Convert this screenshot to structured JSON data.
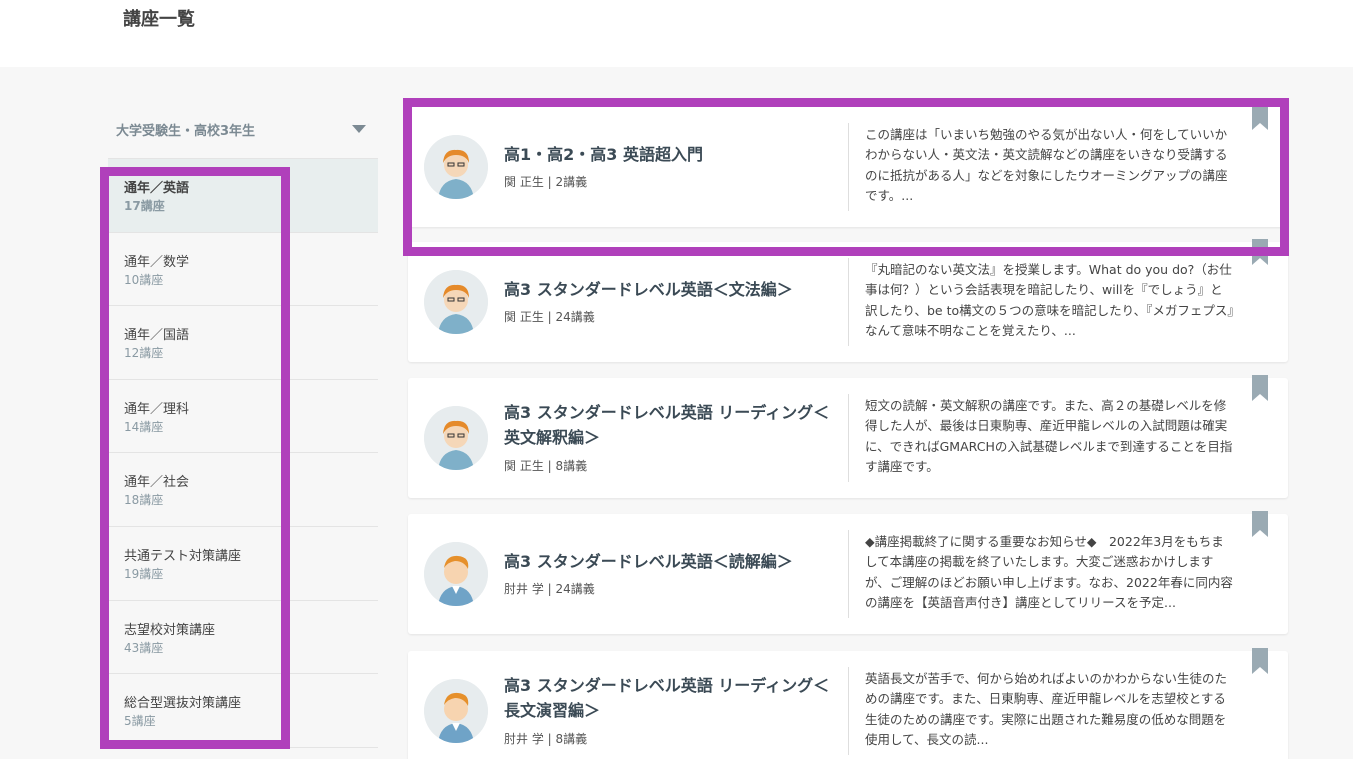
{
  "page": {
    "title": "講座一覧"
  },
  "sidebar": {
    "grade_selector": {
      "label": "大学受験生・高校3年生",
      "icon": "chevron-down-icon"
    },
    "categories": [
      {
        "name": "通年／英語",
        "count": "17講座",
        "active": true
      },
      {
        "name": "通年／数学",
        "count": "10講座"
      },
      {
        "name": "通年／国語",
        "count": "12講座"
      },
      {
        "name": "通年／理科",
        "count": "14講座"
      },
      {
        "name": "通年／社会",
        "count": "18講座"
      },
      {
        "name": "共通テスト対策講座",
        "count": "19講座"
      },
      {
        "name": "志望校対策講座",
        "count": "43講座"
      },
      {
        "name": "総合型選抜対策講座",
        "count": "5講座"
      }
    ]
  },
  "courses": [
    {
      "title": "高1・高2・高3 英語超入門",
      "meta": "関 正生 | 2講義",
      "description": "この講座は「いまいち勉強のやる気が出ない人・何をしていいかわからない人・英文法・英文読解などの講座をいきなり受講するのに抵抗がある人」などを対象にしたウオーミングアップの講座です。...",
      "avatar": "teacher-seki-avatar",
      "bookmark_icon": "bookmark-icon"
    },
    {
      "title": "高3 スタンダードレベル英語＜文法編＞",
      "meta": "関 正生 | 24講義",
      "description": "『丸暗記のない英文法』を授業します。What do you do?（お仕事は何？）という会話表現を暗記したり、willを『でしょう』と訳したり、be to構文の５つの意味を暗記したり、『メガフェプス』なんて意味不明なことを覚えたり、...",
      "avatar": "teacher-seki-avatar",
      "bookmark_icon": "bookmark-icon"
    },
    {
      "title": "高3 スタンダードレベル英語 リーディング＜英文解釈編＞",
      "meta": "関 正生 | 8講義",
      "description": "短文の読解・英文解釈の講座です。また、高２の基礎レベルを修得した人が、最後は日東駒専、産近甲龍レベルの入試問題は確実に、できればGMARCHの入試基礎レベルまで到達することを目指す講座です。",
      "avatar": "teacher-seki-avatar",
      "bookmark_icon": "bookmark-icon"
    },
    {
      "title": "高3 スタンダードレベル英語＜読解編＞",
      "meta": "肘井 学 | 24講義",
      "description": "◆講座掲載終了に関する重要なお知らせ◆　2022年3月をもちまして本講座の掲載を終了いたします。大変ご迷惑おかけしますが、ご理解のほどお願い申し上げます。なお、2022年春に同内容の講座を【英語音声付き】講座としてリリースを予定...",
      "avatar": "teacher-hijii-avatar",
      "bookmark_icon": "bookmark-icon"
    },
    {
      "title": "高3 スタンダードレベル英語 リーディング＜長文演習編＞",
      "meta": "肘井 学 | 8講義",
      "description": "英語長文が苦手で、何から始めればよいのかわからない生徒のための講座です。また、日東駒専、産近甲龍レベルを志望校とする生徒のための講座です。実際に出題された難易度の低めな問題を使用して、長文の読...",
      "avatar": "teacher-hijii-avatar",
      "bookmark_icon": "bookmark-icon"
    }
  ],
  "colors": {
    "highlight": "#b040bb",
    "active_category_bg": "#e8eeee",
    "muted_text": "#8a9aa3",
    "bookmark": "#9aaab3"
  }
}
